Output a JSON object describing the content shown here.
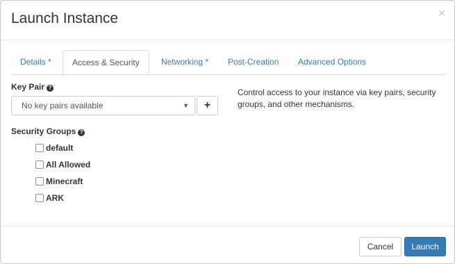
{
  "modal": {
    "title": "Launch Instance",
    "close_glyph": "×"
  },
  "tabs": [
    {
      "label": "Details *",
      "active": false
    },
    {
      "label": "Access & Security",
      "active": true
    },
    {
      "label": "Networking *",
      "active": false
    },
    {
      "label": "Post-Creation",
      "active": false
    },
    {
      "label": "Advanced Options",
      "active": false
    }
  ],
  "key_pair": {
    "label": "Key Pair",
    "help_icon": "question-circle-icon",
    "select_value": "No key pairs available",
    "add_icon": "plus-icon"
  },
  "help_text": "Control access to your instance via key pairs, security groups, and other mechanisms.",
  "security_groups": {
    "label": "Security Groups",
    "help_icon": "question-circle-icon",
    "items": [
      {
        "label": "default",
        "checked": false
      },
      {
        "label": "All Allowed",
        "checked": false
      },
      {
        "label": "Minecraft",
        "checked": false
      },
      {
        "label": "ARK",
        "checked": false
      }
    ]
  },
  "footer": {
    "cancel_label": "Cancel",
    "launch_label": "Launch"
  },
  "colors": {
    "primary": "#337ab7",
    "link": "#337ab7",
    "border": "#dddddd"
  }
}
